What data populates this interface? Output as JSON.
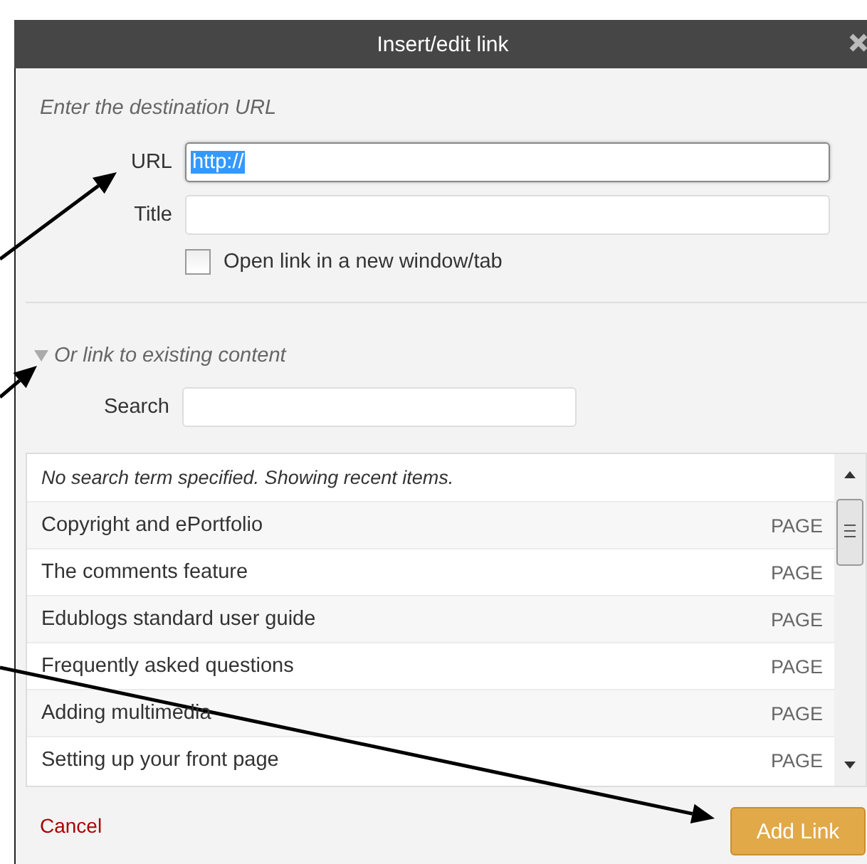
{
  "dialog": {
    "title": "Insert/edit link"
  },
  "destination": {
    "heading": "Enter the destination URL",
    "url": {
      "label": "URL",
      "value": "http://",
      "value_selected": true
    },
    "title": {
      "label": "Title"
    },
    "new_tab": {
      "label": "Open link in a new window/tab",
      "checked": false
    }
  },
  "existing": {
    "heading": "Or link to existing content",
    "expanded": true,
    "search": {
      "label": "Search"
    },
    "notice": "No search term specified. Showing recent items.",
    "items": [
      {
        "title": "Copyright and ePortfolio",
        "type": "PAGE"
      },
      {
        "title": "The comments feature",
        "type": "PAGE"
      },
      {
        "title": "Edublogs standard user guide",
        "type": "PAGE"
      },
      {
        "title": "Frequently asked questions",
        "type": "PAGE"
      },
      {
        "title": "Adding multimedia",
        "type": "PAGE"
      },
      {
        "title": "Setting up your front page",
        "type": "PAGE"
      }
    ]
  },
  "footer": {
    "cancel": "Cancel",
    "submit": "Add Link"
  }
}
